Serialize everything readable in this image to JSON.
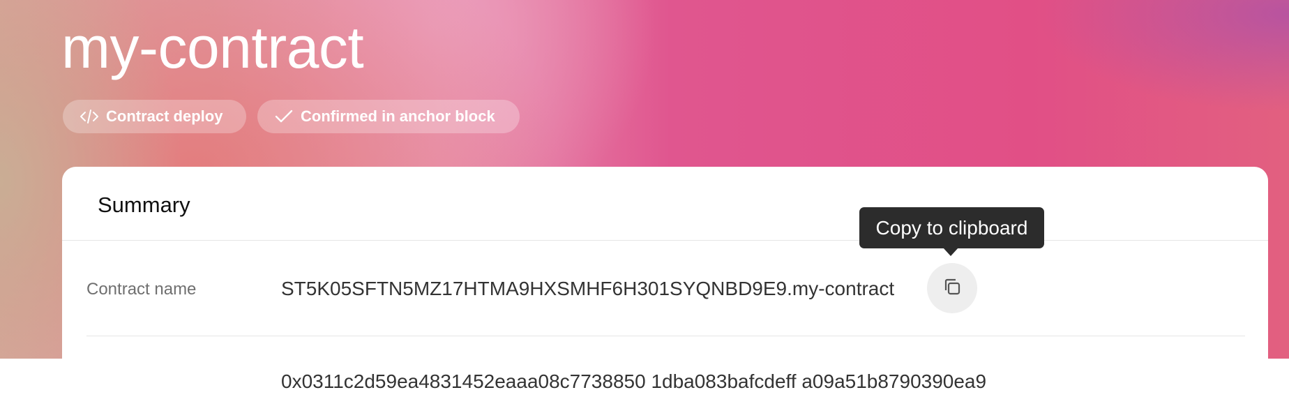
{
  "header": {
    "title": "my-contract",
    "tags": [
      {
        "label": "Contract deploy",
        "icon": "code-icon"
      },
      {
        "label": "Confirmed in anchor block",
        "icon": "checkmark-icon"
      }
    ]
  },
  "summary": {
    "title": "Summary",
    "rows": [
      {
        "label": "Contract name",
        "value": "ST5K05SFTN5MZ17HTMA9HXSMHF6H301SYQNBD9E9.my-contract",
        "action_icon": "copy-icon"
      },
      {
        "label": "",
        "value": "0x0311c2d59ea4831452eaaa08c7738850 1dba083bafcdeff a09a51b8790390ea9"
      }
    ]
  },
  "tooltip": {
    "text": "Copy to clipboard"
  },
  "colors": {
    "hero_pink": "#e14f86",
    "tooltip_bg": "#2c2c2c",
    "card_bg": "#ffffff",
    "label_gray": "#6f6f6f"
  }
}
